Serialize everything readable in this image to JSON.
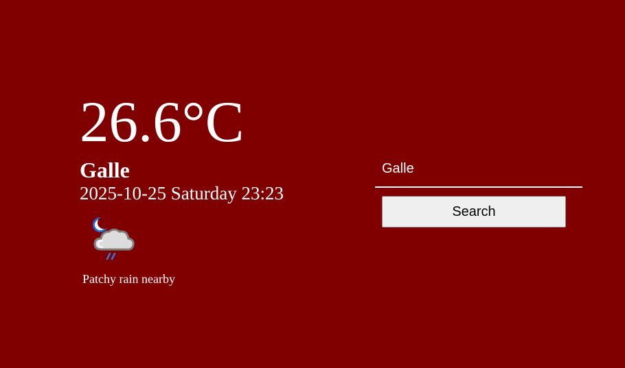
{
  "weather": {
    "temperature": "26.6°C",
    "city": "Galle",
    "datetime": "2025-10-25 Saturday 23:23",
    "condition": "Patchy rain nearby",
    "condition_icon": "night-cloud-rain-icon"
  },
  "search": {
    "input_value": "Galle",
    "placeholder": "",
    "button_label": "Search"
  },
  "colors": {
    "background": "#800000",
    "text": "#ffffff",
    "button_bg": "#efefef"
  }
}
